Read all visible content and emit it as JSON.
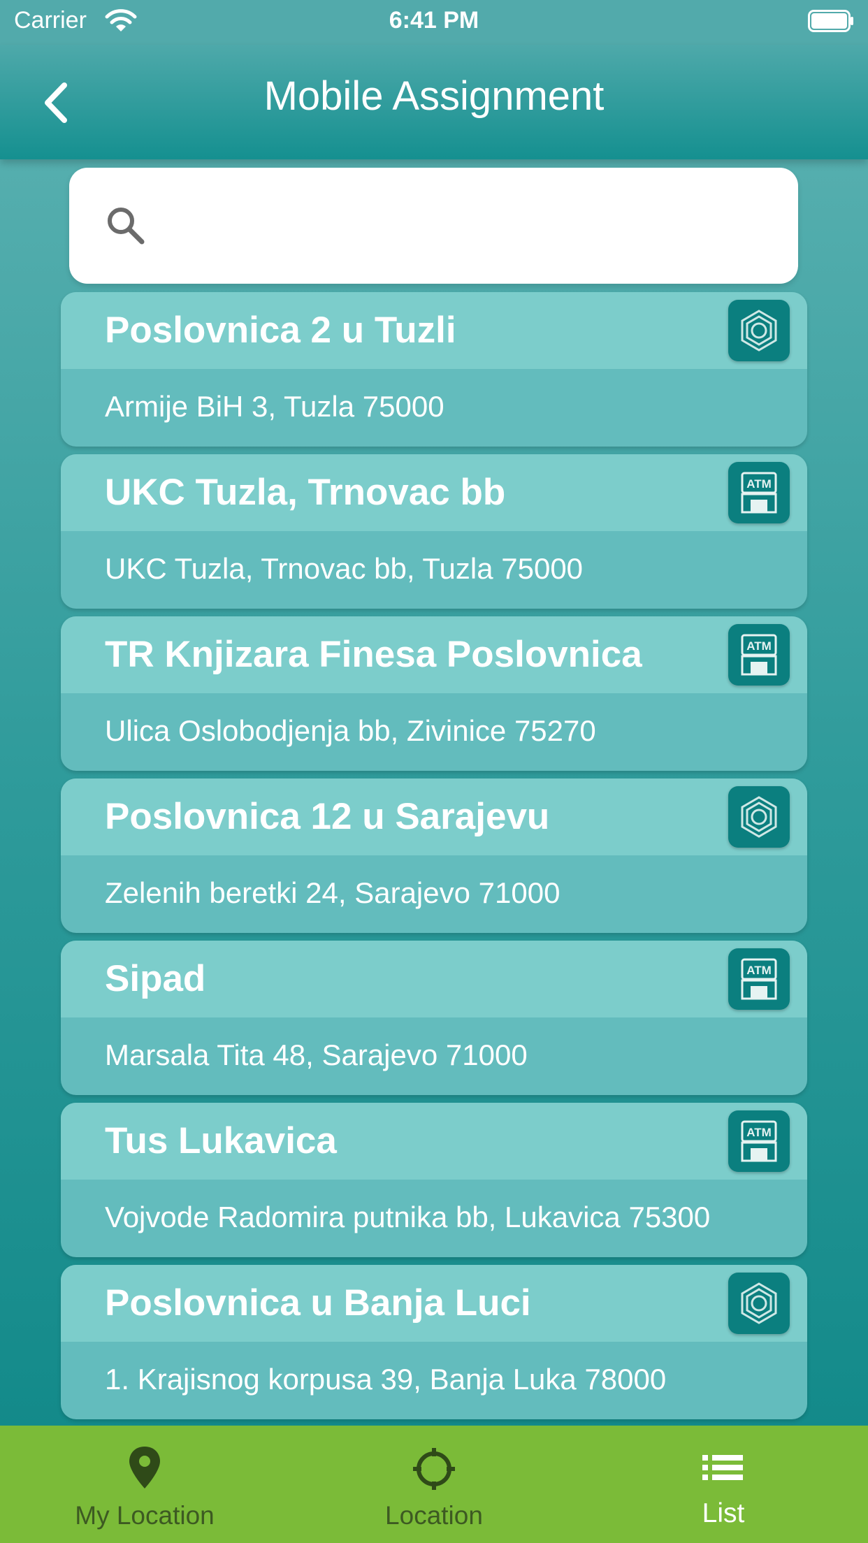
{
  "status_bar": {
    "carrier": "Carrier",
    "time": "6:41 PM"
  },
  "nav": {
    "title": "Mobile Assignment",
    "back_icon": "chevron-left-icon"
  },
  "search": {
    "placeholder": "",
    "value": "",
    "icon": "search-icon"
  },
  "locations": [
    {
      "name": "Poslovnica 2 u Tuzli",
      "address": "Armije BiH 3, Tuzla 75000",
      "type": "branch"
    },
    {
      "name": "UKC Tuzla, Trnovac bb",
      "address": "UKC Tuzla, Trnovac bb, Tuzla 75000",
      "type": "atm"
    },
    {
      "name": "TR Knjizara Finesa Poslovnica",
      "address": "Ulica Oslobodjenja bb, Zivinice 75270",
      "type": "atm"
    },
    {
      "name": "Poslovnica 12 u Sarajevu",
      "address": "Zelenih beretki 24, Sarajevo 71000",
      "type": "branch"
    },
    {
      "name": "Sipad",
      "address": "Marsala Tita 48, Sarajevo 71000",
      "type": "atm"
    },
    {
      "name": "Tus Lukavica",
      "address": "Vojvode Radomira putnika bb, Lukavica 75300",
      "type": "atm"
    },
    {
      "name": "Poslovnica u Banja Luci",
      "address": "1. Krajisnog korpusa 39, Banja Luka 78000",
      "type": "branch"
    }
  ],
  "atm_label": "ATM",
  "tabs": [
    {
      "label": "My Location",
      "icon": "map-pin-icon",
      "active": false
    },
    {
      "label": "Location",
      "icon": "crosshair-icon",
      "active": false
    },
    {
      "label": "List",
      "icon": "list-icon",
      "active": true
    }
  ],
  "colors": {
    "header": "#1f9494",
    "card_head": "#7ccdcb",
    "card_body": "#63bcbd",
    "icon_bg": "#0b7f7f",
    "tab_bar": "#7bbb38"
  }
}
